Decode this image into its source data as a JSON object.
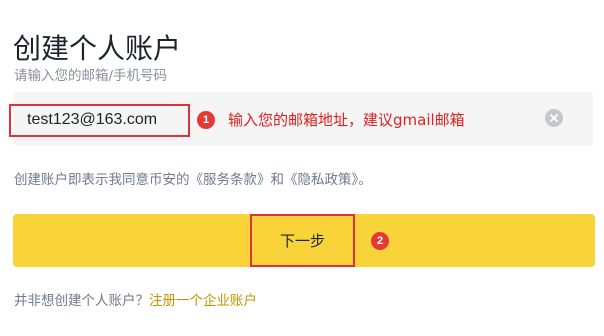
{
  "page_title": "创建个人账户",
  "email_field": {
    "label": "请输入您的邮箱/手机号码",
    "value": "test123@163.com"
  },
  "annotations": {
    "step1_number": "1",
    "step1_text": "输入您的邮箱地址，建议gmail邮箱",
    "step2_number": "2",
    "highlight_color": "#e0323a"
  },
  "terms_text": "创建账户即表示我同意币安的《服务条款》和《隐私政策》。",
  "next_button_label": "下一步",
  "footer": {
    "prompt": "并非想创建个人账户？",
    "link": "注册一个企业账户"
  },
  "colors": {
    "primary_button": "#f8d33a",
    "link": "#c99400",
    "input_background": "#f5f5f5"
  },
  "icons": {
    "clear": "close-circle-icon"
  }
}
